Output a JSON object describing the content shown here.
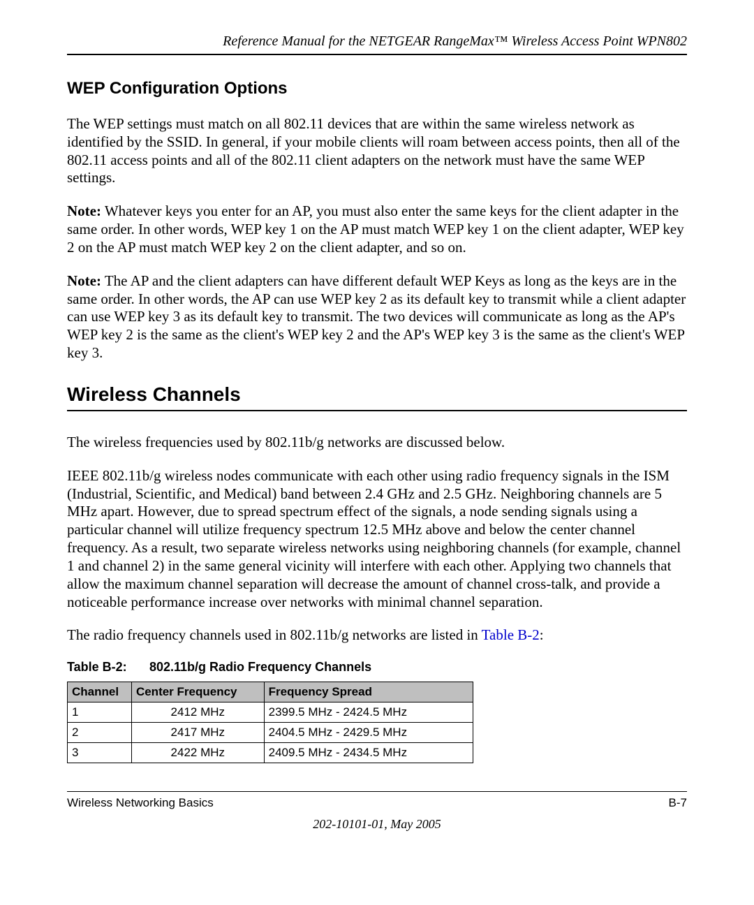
{
  "running_head": "Reference Manual for the NETGEAR RangeMax™ Wireless Access Point WPN802",
  "section1": {
    "heading": "WEP Configuration Options",
    "p1": "The WEP settings must match on all 802.11 devices that are within the same wireless network as identified by the SSID. In general, if your mobile clients will roam between access points, then all of the 802.11 access points and all of the 802.11 client adapters on the network must have the same WEP settings.",
    "note1_label": "Note:",
    "note1_body": " Whatever keys you enter for an AP, you must also enter the same keys for the client adapter in the same order. In other words, WEP key 1 on the AP must match WEP key 1 on the client adapter, WEP key 2 on the AP must match WEP key 2 on the client adapter, and so on.",
    "note2_label": "Note:",
    "note2_body": " The AP and the client adapters can have different default WEP Keys as long as the keys are in the same order. In other words, the AP can use WEP key 2 as its default key to transmit while a client adapter can use WEP key 3 as its default key to transmit. The two devices will communicate as long as the AP's WEP key 2 is the same as the client's WEP key 2 and the AP's WEP key 3 is the same as the client's WEP key 3."
  },
  "section2": {
    "heading": "Wireless Channels",
    "p1": "The wireless frequencies used by 802.11b/g networks are discussed below.",
    "p2": "IEEE 802.11b/g wireless nodes communicate with each other using radio frequency signals in the ISM (Industrial, Scientific, and Medical) band between 2.4 GHz and 2.5 GHz. Neighboring channels are 5 MHz apart. However, due to spread spectrum effect of the signals, a node sending signals using a particular channel will utilize frequency spectrum 12.5 MHz above and below the center channel frequency. As a result, two separate wireless networks using neighboring channels (for example, channel 1 and channel 2) in the same general vicinity will interfere with each other. Applying two channels that allow the maximum channel separation will decrease the amount of channel cross-talk, and provide a noticeable performance increase over networks with minimal channel separation.",
    "p3_pre": "The radio frequency channels used in 802.11b/g networks are listed in ",
    "p3_link": "Table B-2",
    "p3_post": ":"
  },
  "table": {
    "caption_num": "Table B-2:",
    "caption_title": "802.11b/g Radio Frequency Channels",
    "headers": {
      "c1": "Channel",
      "c2": "Center Frequency",
      "c3": "Frequency Spread"
    },
    "rows": [
      {
        "ch": "1",
        "cf": "2412 MHz",
        "fs": "2399.5 MHz - 2424.5 MHz"
      },
      {
        "ch": "2",
        "cf": "2417 MHz",
        "fs": "2404.5 MHz - 2429.5 MHz"
      },
      {
        "ch": "3",
        "cf": "2422 MHz",
        "fs": "2409.5 MHz - 2434.5 MHz"
      }
    ]
  },
  "footer": {
    "left": "Wireless Networking Basics",
    "right": "B-7",
    "date": "202-10101-01, May 2005"
  }
}
